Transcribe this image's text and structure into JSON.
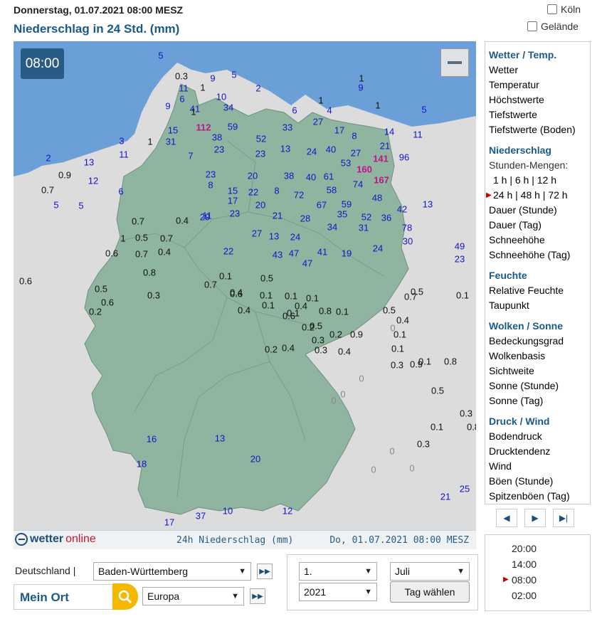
{
  "header": {
    "date_line": "Donnerstag, 01.07.2021 08:00 MESZ",
    "title": "Niederschlag in 24 Std. (mm)",
    "checkbox_koeln": "Köln",
    "checkbox_gelaende": "Gelände"
  },
  "map": {
    "time_badge": "08:00",
    "colors": {
      "sea": "#6a9fd8",
      "land_de": "#8fb5a0",
      "land_foreign": "#dcdcdc",
      "blue": "#1515c8",
      "magenta": "#c0138a"
    },
    "values": [
      [
        "5",
        "b"
      ],
      [
        "0.3",
        "k"
      ],
      [
        "9",
        "b"
      ],
      [
        "5",
        "b"
      ],
      [
        "1",
        "k"
      ],
      [
        "11",
        "b"
      ],
      [
        "1",
        "k"
      ],
      [
        "2",
        "b"
      ],
      [
        "9",
        "b"
      ],
      [
        "10",
        "b"
      ],
      [
        "34",
        "b"
      ],
      [
        "6",
        "b"
      ],
      [
        "41",
        "b"
      ],
      [
        "9",
        "b"
      ],
      [
        "1",
        "k"
      ],
      [
        "6",
        "b"
      ],
      [
        "1",
        "k"
      ],
      [
        "4",
        "b"
      ],
      [
        "1",
        "k"
      ],
      [
        "5",
        "b"
      ],
      [
        "112",
        "m"
      ],
      [
        "59",
        "b"
      ],
      [
        "33",
        "b"
      ],
      [
        "27",
        "b"
      ],
      [
        "8",
        "b"
      ],
      [
        "11",
        "b"
      ],
      [
        "15",
        "b"
      ],
      [
        "38",
        "b"
      ],
      [
        "17",
        "b"
      ],
      [
        "31",
        "b"
      ],
      [
        "52",
        "b"
      ],
      [
        "14",
        "b"
      ],
      [
        "3",
        "b"
      ],
      [
        "1",
        "k"
      ],
      [
        "7",
        "b"
      ],
      [
        "23",
        "b"
      ],
      [
        "13",
        "b"
      ],
      [
        "24",
        "b"
      ],
      [
        "40",
        "b"
      ],
      [
        "27",
        "b"
      ],
      [
        "21",
        "b"
      ],
      [
        "96",
        "b"
      ],
      [
        "2",
        "b"
      ],
      [
        "13",
        "b"
      ],
      [
        "11",
        "b"
      ],
      [
        "23",
        "b"
      ],
      [
        "141",
        "m"
      ],
      [
        "53",
        "b"
      ],
      [
        "160",
        "m"
      ],
      [
        "167",
        "m"
      ],
      [
        "0.9",
        "k"
      ],
      [
        "12",
        "b"
      ],
      [
        "23",
        "b"
      ],
      [
        "20",
        "b"
      ],
      [
        "38",
        "b"
      ],
      [
        "40",
        "b"
      ],
      [
        "61",
        "b"
      ],
      [
        "74",
        "b"
      ],
      [
        "0.7",
        "k"
      ],
      [
        "6",
        "b"
      ],
      [
        "8",
        "b"
      ],
      [
        "15",
        "b"
      ],
      [
        "22",
        "b"
      ],
      [
        "8",
        "b"
      ],
      [
        "72",
        "b"
      ],
      [
        "58",
        "b"
      ],
      [
        "48",
        "b"
      ],
      [
        "5",
        "b"
      ],
      [
        "5",
        "b"
      ],
      [
        "17",
        "b"
      ],
      [
        "20",
        "b"
      ],
      [
        "67",
        "b"
      ],
      [
        "59",
        "b"
      ],
      [
        "42",
        "b"
      ],
      [
        "13",
        "b"
      ],
      [
        "0.7",
        "k"
      ],
      [
        "0.4",
        "k"
      ],
      [
        "11",
        "b"
      ],
      [
        "23",
        "b"
      ],
      [
        "21",
        "b"
      ],
      [
        "28",
        "b"
      ],
      [
        "35",
        "b"
      ],
      [
        "52",
        "b"
      ],
      [
        "36",
        "b"
      ],
      [
        "1",
        "k"
      ],
      [
        "0.5",
        "k"
      ],
      [
        "0.7",
        "k"
      ],
      [
        "29",
        "b"
      ],
      [
        "27",
        "b"
      ],
      [
        "13",
        "b"
      ],
      [
        "24",
        "b"
      ],
      [
        "34",
        "b"
      ],
      [
        "31",
        "b"
      ],
      [
        "78",
        "b"
      ],
      [
        "30",
        "b"
      ],
      [
        "49",
        "b"
      ],
      [
        "0.6",
        "k"
      ],
      [
        "0.7",
        "k"
      ],
      [
        "0.4",
        "k"
      ],
      [
        "22",
        "b"
      ],
      [
        "43",
        "b"
      ],
      [
        "47",
        "b"
      ],
      [
        "41",
        "b"
      ],
      [
        "19",
        "b"
      ],
      [
        "24",
        "b"
      ],
      [
        "23",
        "b"
      ],
      [
        "0.8",
        "k"
      ],
      [
        "0.1",
        "k"
      ],
      [
        "0.5",
        "k"
      ],
      [
        "47",
        "b"
      ],
      [
        "0.6",
        "k"
      ],
      [
        "0.5",
        "k"
      ],
      [
        "0.3",
        "k"
      ],
      [
        "0.7",
        "k"
      ],
      [
        "0.4",
        "k"
      ],
      [
        "0.1",
        "k"
      ],
      [
        "0.1",
        "k"
      ],
      [
        "0.1",
        "k"
      ],
      [
        "0.7",
        "k"
      ],
      [
        "0.5",
        "k"
      ],
      [
        "0.1",
        "k"
      ],
      [
        "0.2",
        "k"
      ],
      [
        "0.6",
        "k"
      ],
      [
        "0.6",
        "k"
      ],
      [
        "0.4",
        "k"
      ],
      [
        "0.1",
        "k"
      ],
      [
        "0.1",
        "k"
      ],
      [
        "0.1",
        "k"
      ],
      [
        "0.5",
        "k"
      ],
      [
        "0.4",
        "k"
      ],
      [
        "0.6",
        "k"
      ],
      [
        "0.4",
        "k"
      ],
      [
        "0.8",
        "k"
      ],
      [
        "0.5",
        "k"
      ],
      [
        "0.3",
        "k"
      ],
      [
        "0.3",
        "k"
      ],
      [
        "0.2",
        "k"
      ],
      [
        "0.4",
        "k"
      ],
      [
        "0.3",
        "k"
      ],
      [
        "0.9",
        "k"
      ],
      [
        "0.1",
        "k"
      ],
      [
        "0.8",
        "k"
      ],
      [
        "0.5",
        "k"
      ],
      [
        "0.3",
        "k"
      ],
      [
        "0.1",
        "k"
      ],
      [
        "0.8",
        "k"
      ],
      [
        "0.3",
        "k"
      ],
      [
        "0.2",
        "k"
      ],
      [
        "0.2",
        "k"
      ],
      [
        "0.9",
        "k"
      ],
      [
        "0.1",
        "k"
      ],
      [
        "0.1",
        "k"
      ],
      [
        "0.4",
        "k"
      ],
      [
        "0",
        "g"
      ],
      [
        "0",
        "g"
      ],
      [
        "0",
        "g"
      ],
      [
        "0",
        "g"
      ],
      [
        "0",
        "g"
      ],
      [
        "0",
        "g"
      ],
      [
        "0",
        "g"
      ],
      [
        "20",
        "b"
      ],
      [
        "13",
        "b"
      ],
      [
        "37",
        "b"
      ],
      [
        "18",
        "b"
      ],
      [
        "16",
        "b"
      ],
      [
        "10",
        "b"
      ],
      [
        "12",
        "b"
      ],
      [
        "17",
        "b"
      ],
      [
        "25",
        "b"
      ],
      [
        "21",
        "b"
      ]
    ]
  },
  "footer": {
    "logo_a": "wetter",
    "logo_b": "online",
    "mid": "24h Niederschlag (mm)",
    "right": "Do, 01.07.2021 08:00 MESZ"
  },
  "sidebar": {
    "sections": [
      {
        "head": "Wetter / Temp.",
        "items": [
          "Wetter",
          "Temperatur",
          "Höchstwerte",
          "Tiefstwerte",
          "Tiefstwerte (Boden)"
        ]
      },
      {
        "head": "Niederschlag",
        "sub": "Stunden-Mengen:",
        "row1": "1 h | 6 h | 12 h",
        "row2": "24 h | 48 h | 72 h",
        "items": [
          "Dauer (Stunde)",
          "Dauer (Tag)",
          "Schneehöhe",
          "Schneehöhe (Tag)"
        ]
      },
      {
        "head": "Feuchte",
        "items": [
          "Relative Feuchte",
          "Taupunkt"
        ]
      },
      {
        "head": "Wolken / Sonne",
        "items": [
          "Bedeckungsgrad",
          "Wolkenbasis",
          "Sichtweite",
          "Sonne (Stunde)",
          "Sonne (Tag)"
        ]
      },
      {
        "head": "Druck / Wind",
        "items": [
          "Bodendruck",
          "Drucktendenz",
          "Wind",
          "Böen (Stunde)",
          "Spitzenböen (Tag)"
        ]
      }
    ]
  },
  "times": [
    "20:00",
    "14:00",
    "08:00",
    "02:00"
  ],
  "controls": {
    "country_label": "Deutschland |",
    "region_select": "Baden-Württemberg",
    "mein_ort": "Mein Ort",
    "area_select": "Europa",
    "day_select": "1.",
    "month_select": "Juli",
    "year_select": "2021",
    "day_button": "Tag wählen"
  }
}
